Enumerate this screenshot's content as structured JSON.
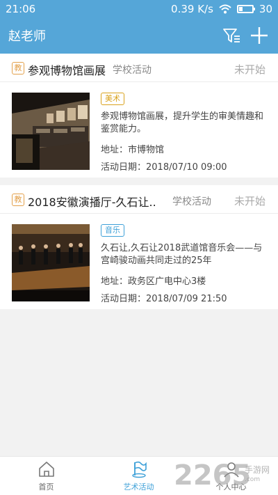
{
  "status_bar": {
    "time": "21:06",
    "speed": "0.39 K/s",
    "battery": "30"
  },
  "app_bar": {
    "title": "赵老师"
  },
  "cards": [
    {
      "badge": "教",
      "title": "参观博物馆画展",
      "category": "学校活动",
      "status": "未开始",
      "tag": "美术",
      "description": "参观博物馆画展，提升学生的审美情趣和鉴赏能力。",
      "address": "地址：市博物馆",
      "date": "活动日期：2018/07/10 09:00"
    },
    {
      "badge": "教",
      "title": "2018安徽演播厅-久石让..",
      "category": "学校活动",
      "status": "未开始",
      "tag": "音乐",
      "description": "久石让,久石让2018武道馆音乐会——与宫崎骏动画共同走过的25年",
      "address": "地址：政务区广电中心3楼",
      "date": "活动日期：2018/07/09 21:50"
    }
  ],
  "tabs": [
    {
      "label": "首页",
      "icon": "home-icon"
    },
    {
      "label": "艺术活动",
      "icon": "flag-icon"
    },
    {
      "label": "个人中心",
      "icon": "person-icon"
    }
  ],
  "watermark": {
    "big": "2265",
    "small": "手游网",
    "tiny": ".com"
  },
  "colors": {
    "primary": "#55a6d8",
    "tag_gold": "#d9a21c",
    "tag_blue": "#3da0d8",
    "badge": "#e3a04a"
  }
}
